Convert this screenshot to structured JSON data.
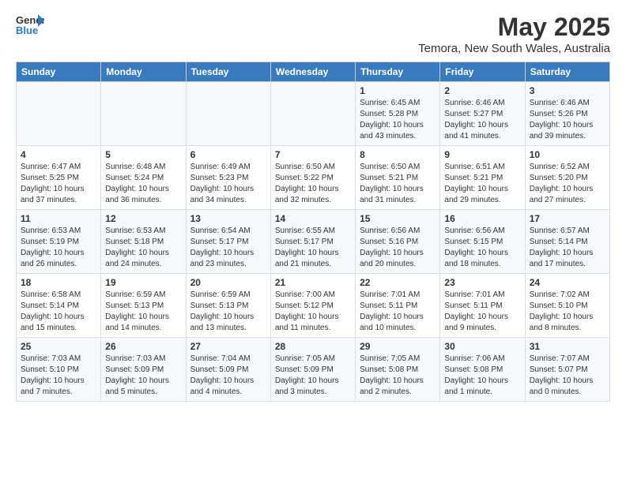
{
  "logo": {
    "line1": "General",
    "line2": "Blue"
  },
  "title": "May 2025",
  "subtitle": "Temora, New South Wales, Australia",
  "days_of_week": [
    "Sunday",
    "Monday",
    "Tuesday",
    "Wednesday",
    "Thursday",
    "Friday",
    "Saturday"
  ],
  "weeks": [
    [
      {
        "day": "",
        "info": ""
      },
      {
        "day": "",
        "info": ""
      },
      {
        "day": "",
        "info": ""
      },
      {
        "day": "",
        "info": ""
      },
      {
        "day": "1",
        "info": "Sunrise: 6:45 AM\nSunset: 5:28 PM\nDaylight: 10 hours\nand 43 minutes."
      },
      {
        "day": "2",
        "info": "Sunrise: 6:46 AM\nSunset: 5:27 PM\nDaylight: 10 hours\nand 41 minutes."
      },
      {
        "day": "3",
        "info": "Sunrise: 6:46 AM\nSunset: 5:26 PM\nDaylight: 10 hours\nand 39 minutes."
      }
    ],
    [
      {
        "day": "4",
        "info": "Sunrise: 6:47 AM\nSunset: 5:25 PM\nDaylight: 10 hours\nand 37 minutes."
      },
      {
        "day": "5",
        "info": "Sunrise: 6:48 AM\nSunset: 5:24 PM\nDaylight: 10 hours\nand 36 minutes."
      },
      {
        "day": "6",
        "info": "Sunrise: 6:49 AM\nSunset: 5:23 PM\nDaylight: 10 hours\nand 34 minutes."
      },
      {
        "day": "7",
        "info": "Sunrise: 6:50 AM\nSunset: 5:22 PM\nDaylight: 10 hours\nand 32 minutes."
      },
      {
        "day": "8",
        "info": "Sunrise: 6:50 AM\nSunset: 5:21 PM\nDaylight: 10 hours\nand 31 minutes."
      },
      {
        "day": "9",
        "info": "Sunrise: 6:51 AM\nSunset: 5:21 PM\nDaylight: 10 hours\nand 29 minutes."
      },
      {
        "day": "10",
        "info": "Sunrise: 6:52 AM\nSunset: 5:20 PM\nDaylight: 10 hours\nand 27 minutes."
      }
    ],
    [
      {
        "day": "11",
        "info": "Sunrise: 6:53 AM\nSunset: 5:19 PM\nDaylight: 10 hours\nand 26 minutes."
      },
      {
        "day": "12",
        "info": "Sunrise: 6:53 AM\nSunset: 5:18 PM\nDaylight: 10 hours\nand 24 minutes."
      },
      {
        "day": "13",
        "info": "Sunrise: 6:54 AM\nSunset: 5:17 PM\nDaylight: 10 hours\nand 23 minutes."
      },
      {
        "day": "14",
        "info": "Sunrise: 6:55 AM\nSunset: 5:17 PM\nDaylight: 10 hours\nand 21 minutes."
      },
      {
        "day": "15",
        "info": "Sunrise: 6:56 AM\nSunset: 5:16 PM\nDaylight: 10 hours\nand 20 minutes."
      },
      {
        "day": "16",
        "info": "Sunrise: 6:56 AM\nSunset: 5:15 PM\nDaylight: 10 hours\nand 18 minutes."
      },
      {
        "day": "17",
        "info": "Sunrise: 6:57 AM\nSunset: 5:14 PM\nDaylight: 10 hours\nand 17 minutes."
      }
    ],
    [
      {
        "day": "18",
        "info": "Sunrise: 6:58 AM\nSunset: 5:14 PM\nDaylight: 10 hours\nand 15 minutes."
      },
      {
        "day": "19",
        "info": "Sunrise: 6:59 AM\nSunset: 5:13 PM\nDaylight: 10 hours\nand 14 minutes."
      },
      {
        "day": "20",
        "info": "Sunrise: 6:59 AM\nSunset: 5:13 PM\nDaylight: 10 hours\nand 13 minutes."
      },
      {
        "day": "21",
        "info": "Sunrise: 7:00 AM\nSunset: 5:12 PM\nDaylight: 10 hours\nand 11 minutes."
      },
      {
        "day": "22",
        "info": "Sunrise: 7:01 AM\nSunset: 5:11 PM\nDaylight: 10 hours\nand 10 minutes."
      },
      {
        "day": "23",
        "info": "Sunrise: 7:01 AM\nSunset: 5:11 PM\nDaylight: 10 hours\nand 9 minutes."
      },
      {
        "day": "24",
        "info": "Sunrise: 7:02 AM\nSunset: 5:10 PM\nDaylight: 10 hours\nand 8 minutes."
      }
    ],
    [
      {
        "day": "25",
        "info": "Sunrise: 7:03 AM\nSunset: 5:10 PM\nDaylight: 10 hours\nand 7 minutes."
      },
      {
        "day": "26",
        "info": "Sunrise: 7:03 AM\nSunset: 5:09 PM\nDaylight: 10 hours\nand 5 minutes."
      },
      {
        "day": "27",
        "info": "Sunrise: 7:04 AM\nSunset: 5:09 PM\nDaylight: 10 hours\nand 4 minutes."
      },
      {
        "day": "28",
        "info": "Sunrise: 7:05 AM\nSunset: 5:09 PM\nDaylight: 10 hours\nand 3 minutes."
      },
      {
        "day": "29",
        "info": "Sunrise: 7:05 AM\nSunset: 5:08 PM\nDaylight: 10 hours\nand 2 minutes."
      },
      {
        "day": "30",
        "info": "Sunrise: 7:06 AM\nSunset: 5:08 PM\nDaylight: 10 hours\nand 1 minute."
      },
      {
        "day": "31",
        "info": "Sunrise: 7:07 AM\nSunset: 5:07 PM\nDaylight: 10 hours\nand 0 minutes."
      }
    ]
  ]
}
